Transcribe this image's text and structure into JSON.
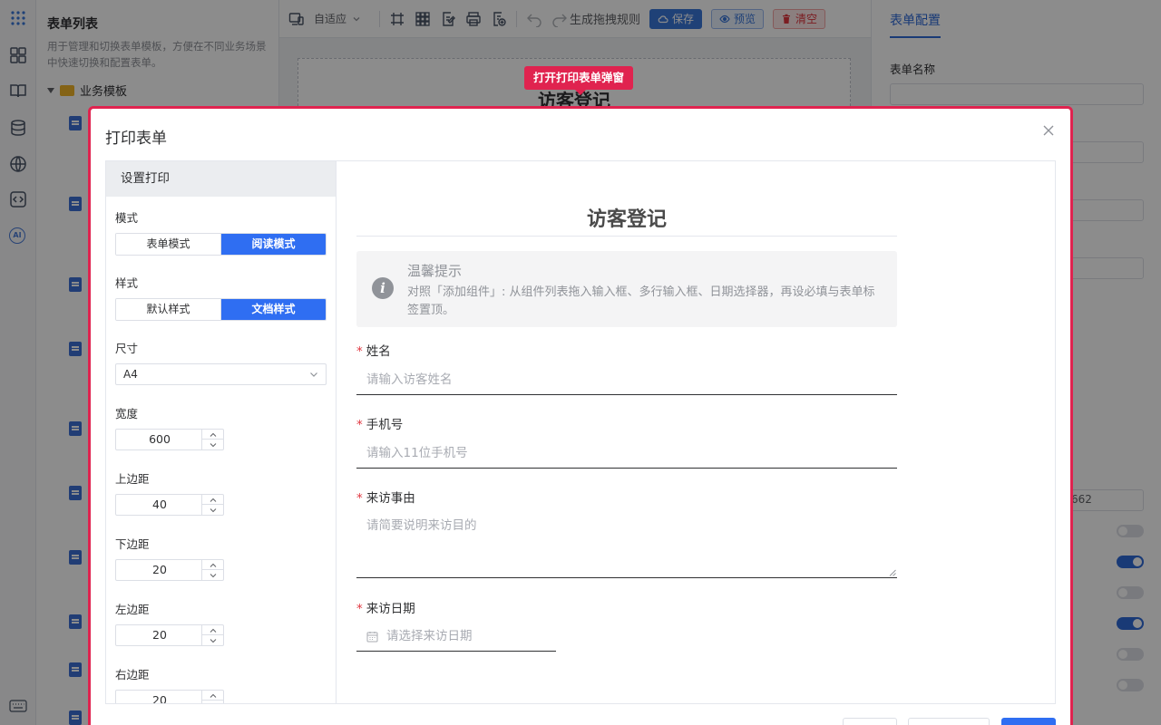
{
  "left_rail": {
    "icons": [
      "apps-grid-icon",
      "widgets-icon",
      "book-icon",
      "database-icon",
      "globe-icon",
      "code-icon",
      "ai-icon",
      "keyboard-icon"
    ],
    "ai_label": "AI"
  },
  "form_list": {
    "title": "表单列表",
    "description": "用于管理和切换表单模板，方便在不同业务场景中快速切换和配置表单。",
    "tree_root": "业务模板"
  },
  "toolbar": {
    "adapt_label": "自适应",
    "generate_rule_label": "生成拖拽规则",
    "save_label": "保存",
    "preview_label": "预览",
    "clear_label": "清空"
  },
  "canvas": {
    "form_title": "访客登记"
  },
  "config_panel": {
    "tab_label": "表单配置",
    "form_name_label": "表单名称",
    "partial_value": "662"
  },
  "tooltip": {
    "text": "打开打印表单弹窗"
  },
  "dialog": {
    "title": "打印表单",
    "settings": {
      "header": "设置打印",
      "mode_label": "模式",
      "mode_options": [
        "表单模式",
        "阅读模式"
      ],
      "mode_selected": "阅读模式",
      "style_label": "样式",
      "style_options": [
        "默认样式",
        "文档样式"
      ],
      "style_selected": "文档样式",
      "size_label": "尺寸",
      "size_value": "A4",
      "width_label": "宽度",
      "width_value": "600",
      "top_margin_label": "上边距",
      "top_margin_value": "40",
      "bottom_margin_label": "下边距",
      "bottom_margin_value": "20",
      "left_margin_label": "左边距",
      "left_margin_value": "20",
      "right_margin_label": "右边距",
      "right_margin_value": "20"
    },
    "preview": {
      "title": "访客登记",
      "tip_title": "温馨提示",
      "tip_text": "对照「添加组件」: 从组件列表拖入输入框、多行输入框、日期选择器，再设必填与表单标签置顶。",
      "fields": [
        {
          "label": "姓名",
          "placeholder": "请输入访客姓名"
        },
        {
          "label": "手机号",
          "placeholder": "请输入11位手机号"
        },
        {
          "label": "来访事由",
          "placeholder": "请简要说明来访目的"
        },
        {
          "label": "来访日期",
          "placeholder": "请选择来访日期"
        }
      ],
      "required_mark": "*"
    }
  },
  "colors": {
    "accent": "#2f6ef2",
    "highlight": "#e0234f"
  }
}
